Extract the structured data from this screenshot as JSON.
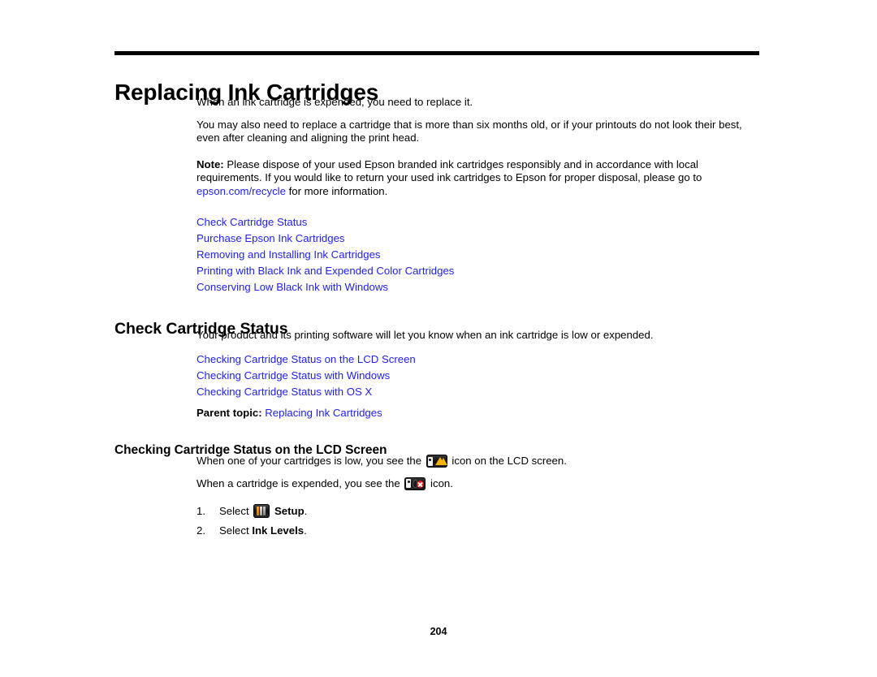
{
  "document": {
    "page_number": "204",
    "link_color": "#2222ee",
    "text_color": "#000000",
    "background_color": "#ffffff"
  },
  "chapter": {
    "title": "Replacing Ink Cartridges",
    "intro_paragraph_1": "When an ink cartridge is expended, you need to replace it.",
    "intro_paragraph_2": "You may also need to replace a cartridge that is more than six months old, or if your printouts do not look their best, even after cleaning and aligning the print head.",
    "note": {
      "label": "Note:",
      "text_before_link": " Please dispose of your used Epson branded ink cartridges responsibly and in accordance with local requirements. If you would like to return your used ink cartridges to Epson for proper disposal, please go to ",
      "link_text": "epson.com/recycle",
      "text_after_link": " for more information."
    },
    "topic_links": [
      "Check Cartridge Status",
      "Purchase Epson Ink Cartridges",
      "Removing and Installing Ink Cartridges",
      "Printing with Black Ink and Expended Color Cartridges",
      "Conserving Low Black Ink with Windows"
    ]
  },
  "section_check_cartridge_status": {
    "heading": "Check Cartridge Status",
    "paragraph": "Your product and its printing software will let you know when an ink cartridge is low or expended.",
    "topic_links": [
      "Checking Cartridge Status on the LCD Screen",
      "Checking Cartridge Status with Windows",
      "Checking Cartridge Status with OS X"
    ],
    "parent_topic": {
      "label": "Parent topic:",
      "link_text": "Replacing Ink Cartridges"
    }
  },
  "subsection_lcd_screen": {
    "heading": "Checking Cartridge Status on the LCD Screen",
    "low_ink_sentence_before": "When one of your cartridges is low, you see the ",
    "low_ink_icon_name": "low-ink-warning-icon",
    "low_ink_sentence_after": " icon on the LCD screen.",
    "expended_sentence_before": "When a cartridge is expended, you see the ",
    "expended_icon_name": "ink-expended-icon",
    "expended_sentence_after": " icon.",
    "steps": [
      {
        "number": "1.",
        "text_before": "Select ",
        "icon_name": "setup-icon",
        "bold_text": "Setup",
        "text_after": "."
      },
      {
        "number": "2.",
        "text_before": "Select ",
        "icon_name": "",
        "bold_text": "Ink Levels",
        "text_after": "."
      }
    ]
  }
}
